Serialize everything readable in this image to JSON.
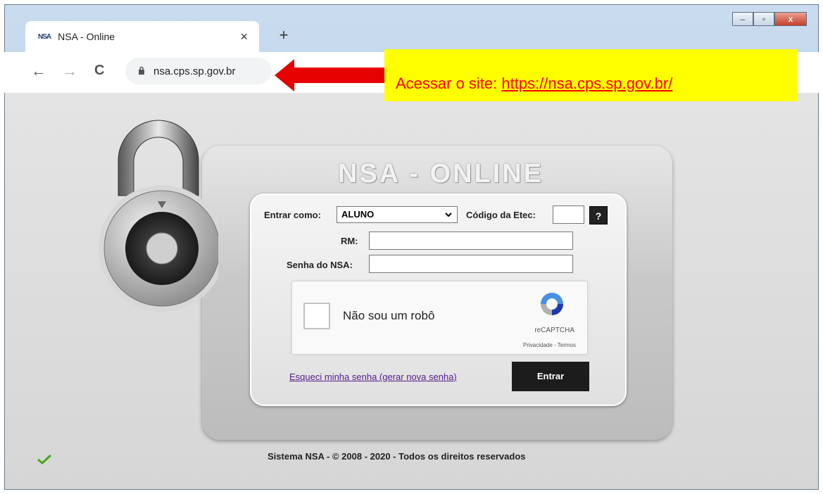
{
  "browser": {
    "tab_title": "NSA - Online",
    "favicon_text": "NSA",
    "tab_close": "×",
    "new_tab": "+",
    "url": "nsa.cps.sp.gov.br",
    "nav": {
      "back": "←",
      "forward": "→",
      "reload": "C"
    }
  },
  "window_controls": {
    "minimize": "–",
    "maximize": "▫",
    "close": "x"
  },
  "annotation": {
    "text_prefix": "Acessar o site: ",
    "link": "https://nsa.cps.sp.gov.br/",
    "background": "#ffff00",
    "text_color": "#ff0000"
  },
  "login": {
    "title": "NSA - ONLINE",
    "enter_as_label": "Entrar como:",
    "enter_as_value": "ALUNO",
    "etec_code_label": "Código da Etec:",
    "etec_code_value": "",
    "help_button": "?",
    "rm_label": "RM:",
    "rm_value": "",
    "password_label": "Senha do NSA:",
    "password_value": "",
    "recaptcha": {
      "label": "Não sou um robô",
      "brand": "reCAPTCHA",
      "links": "Privacidade - Termos"
    },
    "forgot_password": "Esqueci minha senha (gerar nova senha)",
    "submit_button": "Entrar"
  },
  "footer": "Sistema NSA  -  © 2008 - 2020  -  Todos os direitos reservados"
}
